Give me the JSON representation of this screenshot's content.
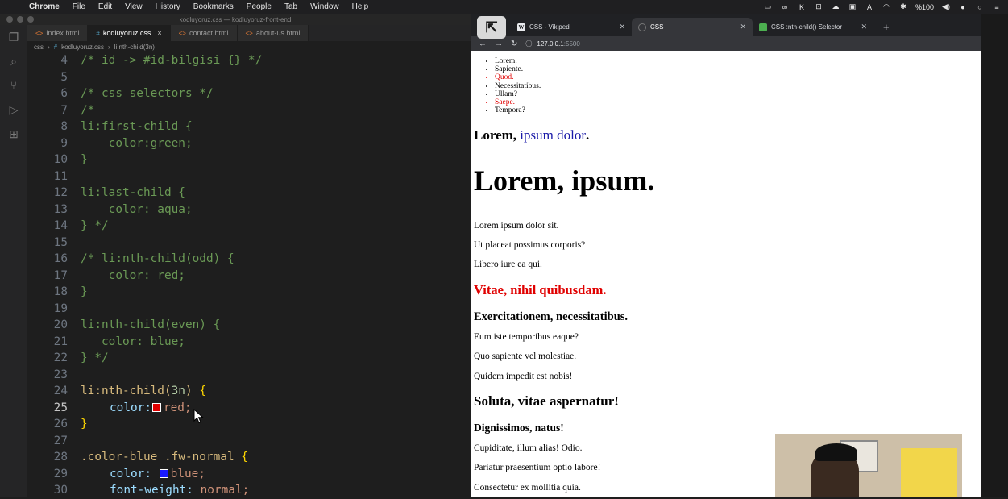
{
  "menubar": {
    "app": "Chrome",
    "items": [
      "File",
      "Edit",
      "View",
      "History",
      "Bookmarks",
      "People",
      "Tab",
      "Window",
      "Help"
    ],
    "battery": "%100"
  },
  "vscode": {
    "window_title": "kodluyoruz.css — kodluyoruz-front-end",
    "tabs": [
      {
        "label": "index.html",
        "ext": "<>",
        "active": false
      },
      {
        "label": "kodluyoruz.css",
        "ext": "#",
        "active": true
      },
      {
        "label": "contact.html",
        "ext": "<>",
        "active": false
      },
      {
        "label": "about-us.html",
        "ext": "<>",
        "active": false
      }
    ],
    "breadcrumb": [
      "css",
      "kodluyoruz.css",
      "li:nth-child(3n)"
    ],
    "lines": [
      {
        "n": "4",
        "text": "/* id -> #id-bilgisi {} */"
      },
      {
        "n": "5",
        "text": ""
      },
      {
        "n": "6",
        "text": "/* css selectors */"
      },
      {
        "n": "7",
        "text": "/*"
      },
      {
        "n": "8",
        "text": "li:first-child {"
      },
      {
        "n": "9",
        "text": "    color:green;"
      },
      {
        "n": "10",
        "text": "}"
      },
      {
        "n": "11",
        "text": ""
      },
      {
        "n": "12",
        "text": "li:last-child {"
      },
      {
        "n": "13",
        "text": "    color: aqua;"
      },
      {
        "n": "14",
        "text": "} */"
      },
      {
        "n": "15",
        "text": ""
      },
      {
        "n": "16",
        "text": "/* li:nth-child(odd) {"
      },
      {
        "n": "17",
        "text": "    color: red;"
      },
      {
        "n": "18",
        "text": "}"
      },
      {
        "n": "19",
        "text": ""
      },
      {
        "n": "20",
        "text": "li:nth-child(even) {"
      },
      {
        "n": "21",
        "text": "   color: blue;"
      },
      {
        "n": "22",
        "text": "} */"
      },
      {
        "n": "23",
        "text": ""
      },
      {
        "n": "24",
        "sel": "li:nth-child(",
        "num": "3n",
        "sel_end": ")",
        "brace": "{"
      },
      {
        "n": "25",
        "prop": "color:",
        "val": "red;",
        "swatch": "#e00000"
      },
      {
        "n": "26",
        "brace": "}"
      },
      {
        "n": "27",
        "text": ""
      },
      {
        "n": "28",
        "sel": ".color-blue .fw-normal",
        "brace": "{"
      },
      {
        "n": "29",
        "prop": "color:",
        "val": "blue;",
        "swatch": "#1a1aff"
      },
      {
        "n": "30",
        "prop": "font-weight:",
        "val": "normal;"
      }
    ]
  },
  "chrome": {
    "tabs": [
      {
        "label": "CSS - Vikipedi",
        "icon": "W",
        "active": false
      },
      {
        "label": "CSS",
        "icon": "",
        "active": true
      },
      {
        "label": "CSS :nth-child() Selector",
        "icon": "css",
        "active": false
      }
    ],
    "url_host": "127.0.0.1",
    "url_port": ":5500"
  },
  "page": {
    "list": [
      {
        "text": "Lorem.",
        "red": false
      },
      {
        "text": "Sapiente.",
        "red": false
      },
      {
        "text": "Quod.",
        "red": true
      },
      {
        "text": "Necessitatibus.",
        "red": false
      },
      {
        "text": "Ullam?",
        "red": false
      },
      {
        "text": "Saepe.",
        "red": true
      },
      {
        "text": "Tempora?",
        "red": false
      }
    ],
    "h2_a": "Lorem,",
    "h2_b": "ipsum dolor",
    "h2_c": ".",
    "h1": "Lorem, ipsum.",
    "p1": "Lorem ipsum dolor sit.",
    "p2": "Ut placeat possimus corporis?",
    "p3": "Libero iure ea qui.",
    "h_red": "Vitae, nihil quibusdam.",
    "h_exc": "Exercitationem, necessitatibus.",
    "p4": "Eum iste temporibus eaque?",
    "p5": "Quo sapiente vel molestiae.",
    "p6": "Quidem impedit est nobis!",
    "h_sol": "Soluta, vitae aspernatur!",
    "h_dig": "Dignissimos, natus!",
    "p7": "Cupiditate, illum alias! Odio.",
    "p8": "Pariatur praesentium optio labore!",
    "p9": "Consectetur ex mollitia quia."
  }
}
